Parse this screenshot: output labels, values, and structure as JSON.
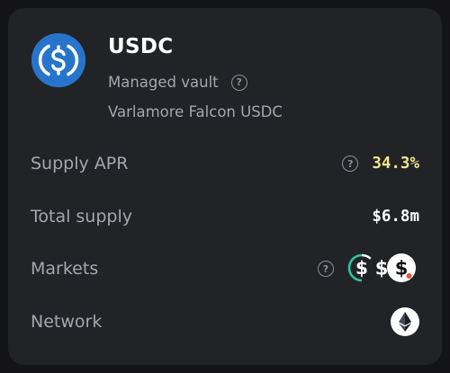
{
  "vault": {
    "symbol": "USDC",
    "type_label": "Managed vault",
    "name": "Varlamore Falcon USDC",
    "logo_icon": "usdc-coin-icon",
    "logo_color": "#2775ca"
  },
  "rows": {
    "supply_apr": {
      "label": "Supply APR",
      "value": "34.3%",
      "value_color": "#f2e58a"
    },
    "total_supply": {
      "label": "Total supply",
      "value": "$6.8m"
    },
    "markets": {
      "label": "Markets",
      "icons": [
        "dollar-token-icon",
        "dollar-token-icon",
        "dollar-token-icon"
      ]
    },
    "network": {
      "label": "Network",
      "icon": "ethereum-icon"
    }
  },
  "help_glyph": "?",
  "colors": {
    "background": "#141416",
    "card": "#222327",
    "muted_text": "#a5a7ad",
    "accent_green": "#2ec4a3",
    "accent_red": "#e0533d"
  }
}
